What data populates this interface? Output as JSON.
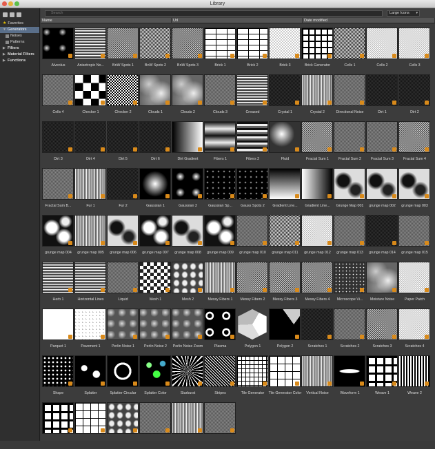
{
  "window": {
    "title": "Library"
  },
  "sidebar": {
    "items": [
      {
        "label": "Favorites",
        "icon": "star-icon"
      },
      {
        "label": "Generators",
        "icon": "arrow-down-icon",
        "selected": true
      },
      {
        "label": "Noises",
        "icon": "folder-icon"
      },
      {
        "label": "Patterns",
        "icon": "folder-icon"
      },
      {
        "label": "Filters",
        "icon": "arrow-right-icon"
      },
      {
        "label": "Material Filters",
        "icon": "arrow-right-icon"
      },
      {
        "label": "Functions",
        "icon": "arrow-right-icon"
      }
    ]
  },
  "toolbar": {
    "search_placeholder": "Search",
    "view_mode": "Large Icons"
  },
  "columns": [
    "Name",
    "Url",
    "Date modified"
  ],
  "items": [
    "Alveolus",
    "Anisotropic No...",
    "BnW Spots 1",
    "BnW Spots 2",
    "BnW Spots 3",
    "Brick 1",
    "Brick 2",
    "Brick 3",
    "Brick Generator",
    "Cells 1",
    "Cells 2",
    "Cells 3",
    "Cells 4",
    "Checker 1",
    "Checker 2",
    "Clouds 1",
    "Clouds 2",
    "Clouds 3",
    "Creased",
    "Crystal 1",
    "Crystal 2",
    "Directional Noise",
    "Dirt 1",
    "Dirt 2",
    "Dirt 3",
    "Dirt 4",
    "Dirt 5",
    "Dirt 6",
    "Dirt Gradient",
    "Fibers 1",
    "Fibers 2",
    "Fluid",
    "Fractal Sum 1",
    "Fractal Sum 2",
    "Fractal Sum 3",
    "Fractal Sum 4",
    "Fractal Sum B...",
    "Fur 1",
    "Fur 2",
    "Gaussian 1",
    "Gaussian 2",
    "Gaussian Sp...",
    "Gauss Spots 2",
    "Gradient Line...",
    "Gradient Line...",
    "Grunge Map 001",
    "grunge map 002",
    "grunge map 003",
    "grunge map 004",
    "grunge map 005",
    "grunge map 006",
    "grunge map 007",
    "grunge map 008",
    "grunge map 009",
    "grunge map 010",
    "grunge map 011",
    "grunge map 012",
    "grunge map 013",
    "grunge map 014",
    "grunge map 015",
    "Herb 1",
    "Horizontal Lines",
    "Liquid",
    "Mesh 1",
    "Mesh 2",
    "Messy Fibers 1",
    "Messy Fibers 2",
    "Messy Fibers 3",
    "Messy Fibers 4",
    "Microscope Vi...",
    "Moisture Noise",
    "Paper Patch",
    "Parquet 1",
    "Pavement 1",
    "Perlin Noise 1",
    "Perlin Noise 2",
    "Perlin Noise Zoom",
    "Plasma",
    "Polygon 1",
    "Polygon 2",
    "Scratches 1",
    "Scratches 2",
    "Scratches 3",
    "Scratches 4",
    "Shape",
    "Splatter",
    "Splatter Circular",
    "Splatter Color",
    "Starburst",
    "Stripes",
    "Tile Generator",
    "Tile Generator Color",
    "Vertical Noise",
    "Waveform 1",
    "Weave 1",
    "Weave 2",
    "",
    "",
    "",
    "",
    "",
    ""
  ]
}
